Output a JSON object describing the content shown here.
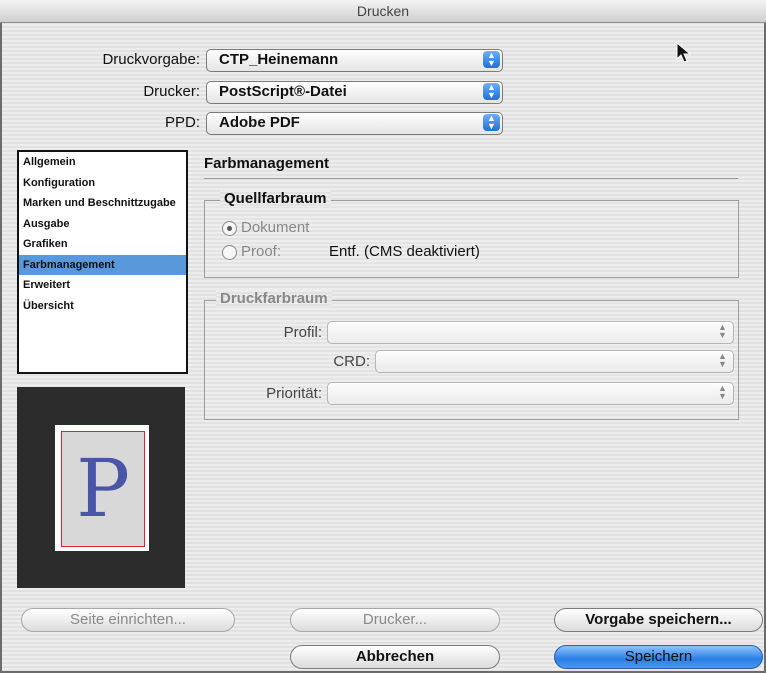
{
  "window": {
    "title": "Drucken"
  },
  "top": {
    "preset_label": "Druckvorgabe:",
    "preset_value": "CTP_Heinemann",
    "printer_label": "Drucker:",
    "printer_value": "PostScript®-Datei",
    "ppd_label": "PPD:",
    "ppd_value": "Adobe PDF"
  },
  "sidebar": {
    "items": [
      {
        "label": "Allgemein"
      },
      {
        "label": "Konfiguration"
      },
      {
        "label": "Marken und Beschnittzugabe"
      },
      {
        "label": "Ausgabe"
      },
      {
        "label": "Grafiken"
      },
      {
        "label": "Farbmanagement",
        "selected": true
      },
      {
        "label": "Erweitert"
      },
      {
        "label": "Übersicht"
      }
    ]
  },
  "preview": {
    "letter": "P"
  },
  "panel": {
    "title": "Farbmanagement",
    "source": {
      "title": "Quellfarbraum",
      "option_document": "Dokument",
      "option_proof": "Proof:",
      "proof_value": "Entf. (CMS deaktiviert)",
      "selected": "Dokument"
    },
    "print": {
      "title": "Druckfarbraum",
      "profile_label": "Profil:",
      "crd_label": "CRD:",
      "priority_label": "Priorität:"
    }
  },
  "buttons": {
    "page_setup": "Seite einrichten...",
    "printer": "Drucker...",
    "save_preset": "Vorgabe speichern...",
    "cancel": "Abbrechen",
    "save": "Speichern"
  },
  "colors": {
    "accent": "#2a7ee6",
    "selection": "#5a98dc",
    "preview_bg": "#2c2c2c",
    "letter": "#4a55a8"
  }
}
